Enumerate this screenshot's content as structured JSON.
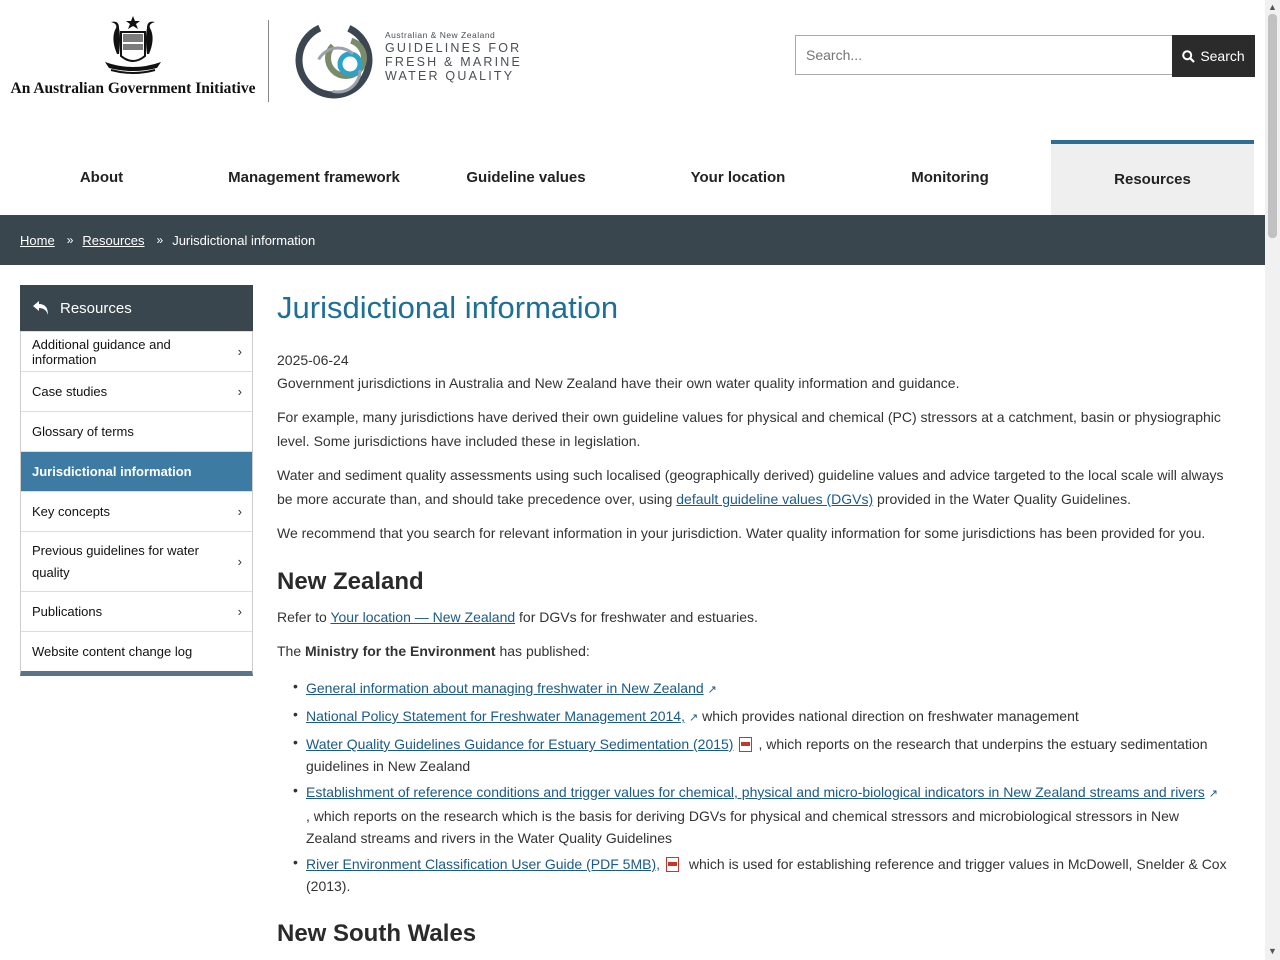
{
  "header": {
    "gov_initiative": "An Australian Government Initiative",
    "logo_small": "Australian & New Zealand",
    "logo_lines": [
      "GUIDELINES FOR",
      "FRESH & MARINE",
      "WATER QUALITY"
    ],
    "search_placeholder": "Search...",
    "search_button": "Search"
  },
  "nav": {
    "items": [
      {
        "label": "About"
      },
      {
        "label": "Management framework"
      },
      {
        "label": "Guideline values"
      },
      {
        "label": "Your location"
      },
      {
        "label": "Monitoring"
      },
      {
        "label": "Resources"
      }
    ]
  },
  "breadcrumb": {
    "home": "Home",
    "resources": "Resources",
    "current": "Jurisdictional information"
  },
  "sidebar": {
    "title": "Resources",
    "items": [
      {
        "label": "Additional guidance and information"
      },
      {
        "label": "Case studies"
      },
      {
        "label": "Glossary of terms"
      },
      {
        "label": "Jurisdictional information"
      },
      {
        "label": "Key concepts"
      },
      {
        "label": "Previous guidelines for water quality"
      },
      {
        "label": "Publications"
      },
      {
        "label": "Website content change log"
      }
    ]
  },
  "main": {
    "title": "Jurisdictional information",
    "date": "2025-06-24",
    "p1": "Government jurisdictions in Australia and New Zealand have their own water quality information and guidance.",
    "p2": "For example, many jurisdictions have derived their own guideline values for physical and chemical (PC) stressors at a catchment, basin or physiographic level. Some jurisdictions have included these in legislation.",
    "p3_before": "Water and sediment quality assessments using such localised (geographically derived) guideline values and advice targeted to the local scale will always be more accurate than, and should take precedence over, using ",
    "p3_link": "default guideline values (DGVs)",
    "p3_after": " provided in the Water Quality Guidelines.",
    "p4": "We recommend that you search for relevant information in your jurisdiction. Water quality information for some jurisdictions has been provided for you.",
    "nz_heading": "New Zealand",
    "nz_refer_before": "Refer to ",
    "nz_refer_link": "Your location — New Zealand",
    "nz_refer_after": " for DGVs for freshwater and estuaries.",
    "nz_the": "The ",
    "nz_ministry": "Ministry for the Environment",
    "nz_published": " has published:",
    "list": {
      "l1_link": "General information about managing freshwater in New Zealand",
      "l2_link": "National Policy Statement for Freshwater Management 2014,",
      "l2_after": " which provides national direction on freshwater management",
      "l3_link": "Water Quality Guidelines Guidance for Estuary Sedimentation (2015)",
      "l3_after": ", which reports on the research that underpins the estuary sedimentation guidelines in New Zealand",
      "l4_link": "Establishment of reference conditions and trigger values for chemical, physical and micro-biological indicators in New Zealand streams and rivers",
      "l4_after": ", which reports on the research which is the basis for deriving DGVs for physical and chemical stressors and microbiological stressors in New Zealand streams and rivers in the Water Quality Guidelines",
      "l5_link": "River Environment Classification User Guide (PDF 5MB),",
      "l5_after": " which is used for establishing reference and trigger values in McDowell, Snelder & Cox (2013)."
    },
    "nsw_heading": "New South Wales"
  },
  "colors": {
    "accent": "#1d6f94",
    "dark_bar": "#39464e",
    "active_side": "#3d7ba2"
  }
}
